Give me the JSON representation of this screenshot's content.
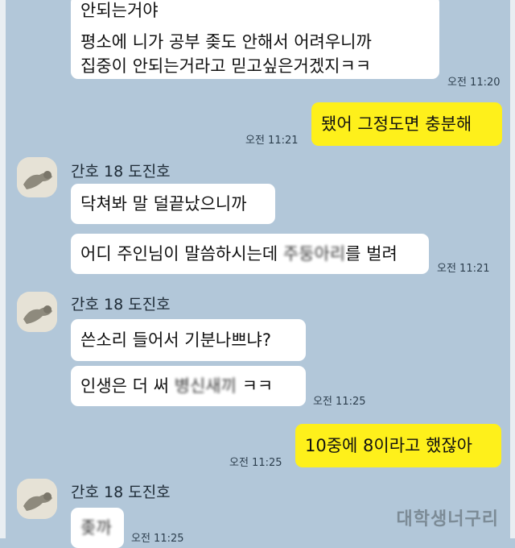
{
  "chat": {
    "msg1": {
      "lines": [
        "안되는거야",
        "평소에 니가 공부 좆도 안해서 어려우니까",
        "집중이 안되는거라고 믿고싶은거겠지ㅋㅋ"
      ],
      "time": "오전 11:20"
    },
    "msg2": {
      "text": "됐어 그정도면 충분해",
      "time": "오전 11:21"
    },
    "group1": {
      "name": "간호 18 도진호",
      "msg_a": "닥쳐봐 말 덜끝났으니까",
      "msg_b_before": "어디 주인님이 말씀하시는데 ",
      "msg_b_blur": "주둥아리",
      "msg_b_after": "를 벌려",
      "time": "오전 11:21"
    },
    "group2": {
      "name": "간호 18 도진호",
      "msg_a": "쓴소리 들어서 기분나쁘냐?",
      "msg_b_before": "인생은 더 써 ",
      "msg_b_blur": "병신새끼",
      "msg_b_after": " ㅋㅋ",
      "time": "오전 11:25"
    },
    "msg3": {
      "text": "10중에 8이라고 했잖아",
      "time": "오전 11:25"
    },
    "group3": {
      "name": "간호 18 도진호",
      "msg_blur": "좆까",
      "time": "오전 11:25"
    }
  },
  "watermark": "대학생너구리",
  "colors": {
    "background": "#b2c7d9",
    "my_bubble": "#fef01b",
    "their_bubble": "#ffffff"
  }
}
